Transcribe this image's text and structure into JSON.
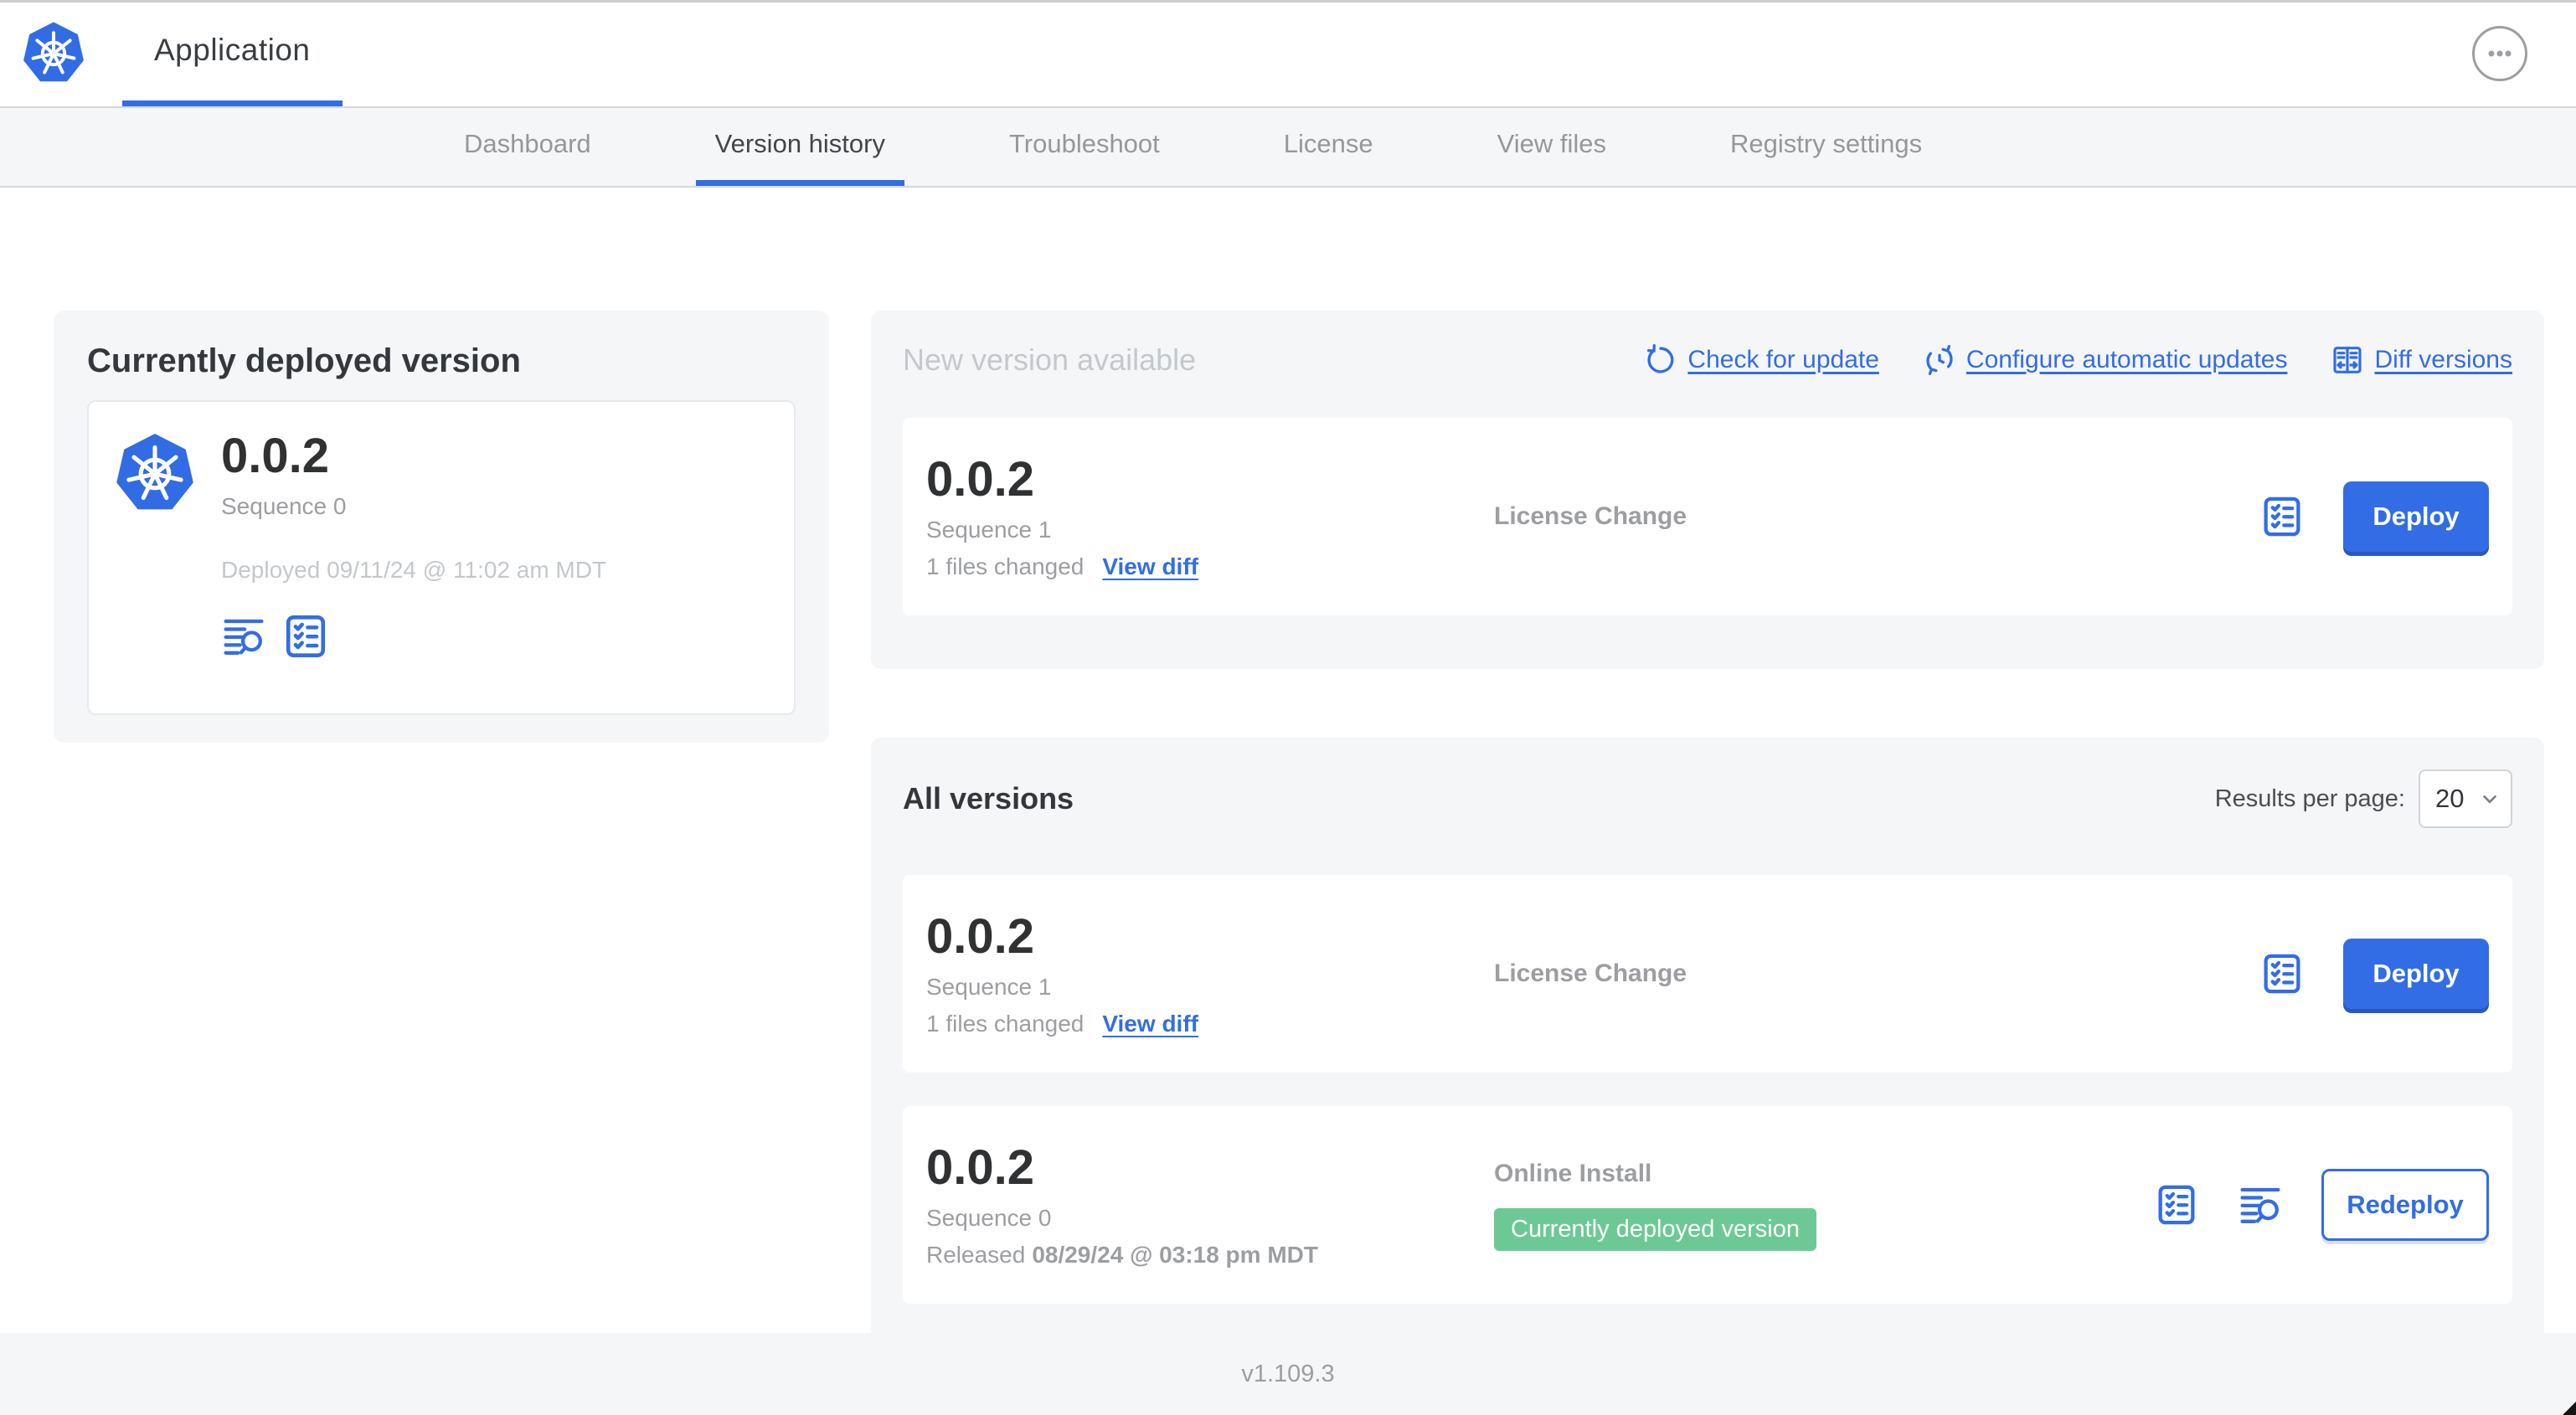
{
  "header": {
    "title": "Application"
  },
  "nav": {
    "tabs": [
      {
        "label": "Dashboard",
        "active": false
      },
      {
        "label": "Version history",
        "active": true
      },
      {
        "label": "Troubleshoot",
        "active": false
      },
      {
        "label": "License",
        "active": false
      },
      {
        "label": "View files",
        "active": false
      },
      {
        "label": "Registry settings",
        "active": false
      }
    ]
  },
  "current_version": {
    "title": "Currently deployed version",
    "version": "0.0.2",
    "sequence": "Sequence 0",
    "deployed": "Deployed 09/11/24 @ 11:02 am MDT"
  },
  "new_version": {
    "title": "New version available",
    "links": [
      {
        "label": "Check for update",
        "icon": "refresh-icon"
      },
      {
        "label": "Configure automatic updates",
        "icon": "schedule-update-icon"
      },
      {
        "label": "Diff versions",
        "icon": "diff-icon"
      }
    ],
    "card": {
      "version": "0.0.2",
      "sequence": "Sequence 1",
      "files_changed": "1 files changed",
      "view_diff_label": "View diff",
      "source": "License Change",
      "action_label": "Deploy"
    }
  },
  "all_versions": {
    "title": "All versions",
    "results_per_page": {
      "label": "Results per page:",
      "value": "20"
    },
    "rows": [
      {
        "version": "0.0.2",
        "sequence": "Sequence 1",
        "files_changed": "1 files changed",
        "view_diff_label": "View diff",
        "source": "License Change",
        "action_label": "Deploy"
      },
      {
        "version": "0.0.2",
        "sequence": "Sequence 0",
        "released_prefix": "Released",
        "released_date": "08/29/24 @ 03:18 pm MDT",
        "source": "Online Install",
        "badge": "Currently deployed version",
        "action_label": "Redeploy"
      }
    ]
  },
  "footer": {
    "version": "v1.109.3"
  },
  "icons": {
    "brand": "kubernetes-logo-icon",
    "menu": "ellipsis-icon",
    "logs": "logs-icon",
    "checks": "checklist-icon",
    "refresh": "refresh-icon",
    "schedule": "schedule-update-icon",
    "diff": "diff-icon",
    "chevron": "chevron-down-icon"
  },
  "colors": {
    "accent_blue": "#326de6",
    "badge_green": "#6cc996",
    "panel_gray": "#f5f6f8",
    "text_dark": "#32363a",
    "text_muted": "#9c9ea1",
    "text_faint": "#c4c8cc"
  }
}
